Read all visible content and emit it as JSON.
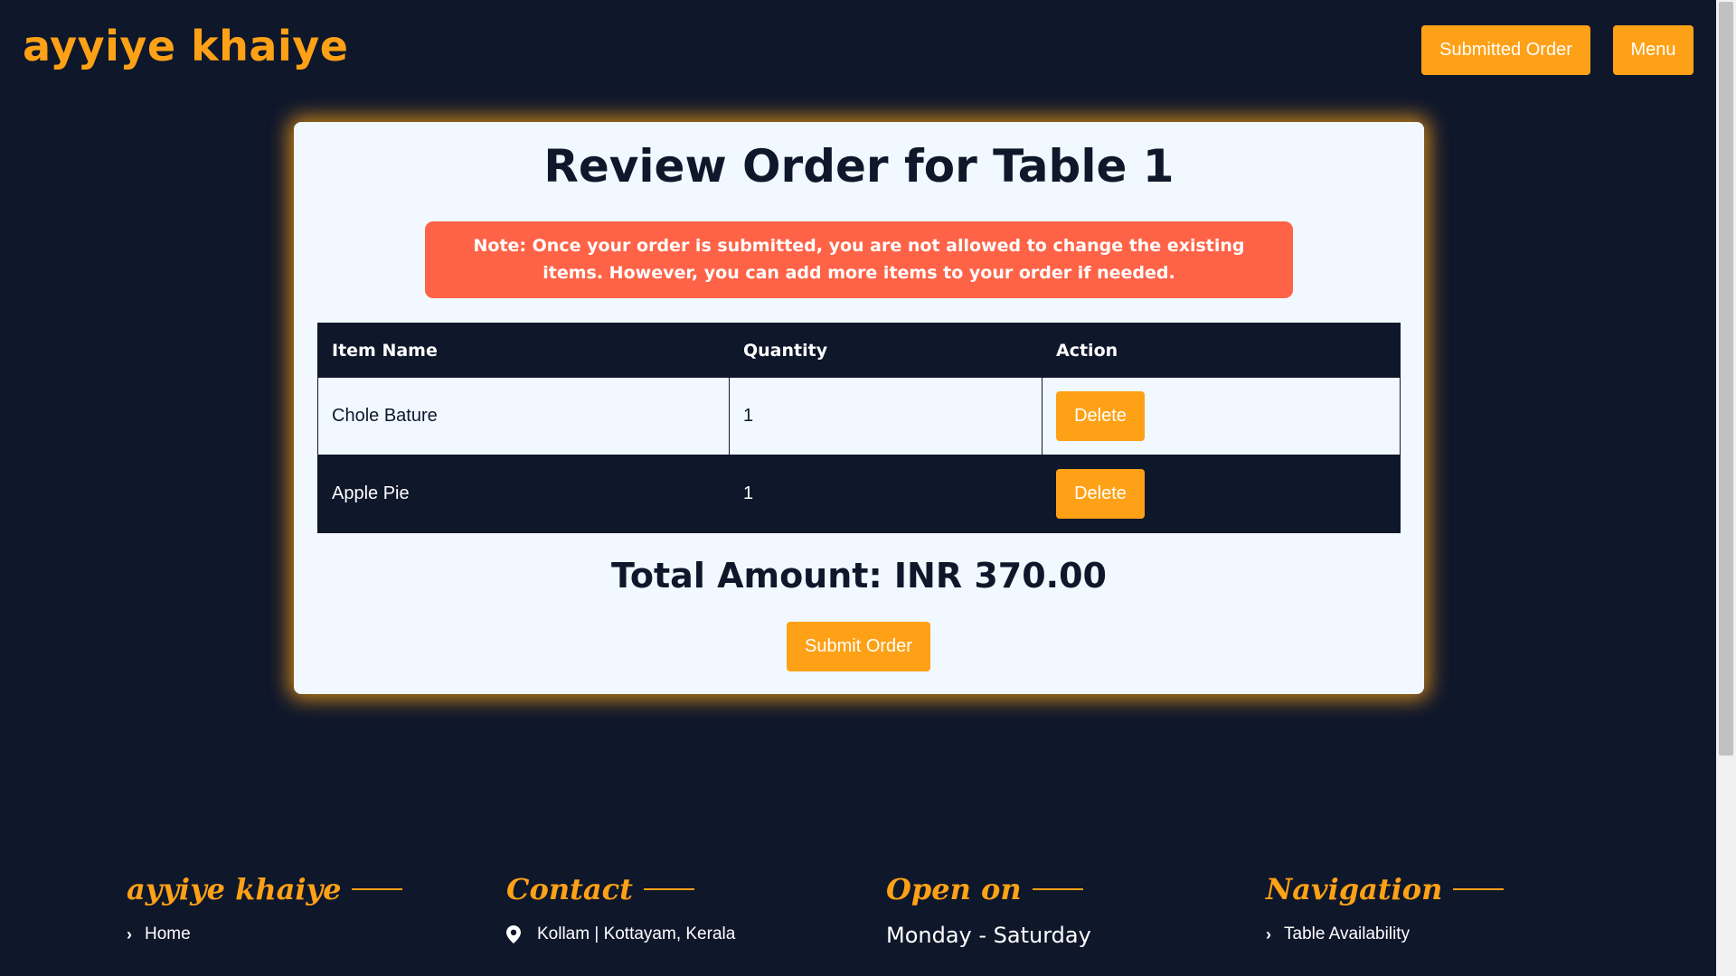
{
  "header": {
    "brand": "ayyiye khaiye",
    "submitted_order_label": "Submitted Order",
    "menu_label": "Menu"
  },
  "card": {
    "title": "Review Order for Table 1",
    "note_label": "Note:",
    "note_text": " Once your order is submitted, you are not allowed to change the existing items. However, you can add more items to your order if needed.",
    "table": {
      "headers": [
        "Item Name",
        "Quantity",
        "Action"
      ],
      "rows": [
        {
          "item": "Chole Bature",
          "quantity": "1",
          "action": "Delete"
        },
        {
          "item": "Apple Pie",
          "quantity": "1",
          "action": "Delete"
        }
      ]
    },
    "total": "Total Amount: INR 370.00",
    "submit_label": "Submit Order"
  },
  "footer": {
    "brand_heading": "ayyiye khaiye",
    "brand_link": "Home",
    "contact_heading": "Contact",
    "contact_address": "Kollam | Kottayam, Kerala",
    "open_heading": "Open on",
    "open_days": "Monday - Saturday",
    "nav_heading": "Navigation",
    "nav_link": "Table Availability"
  },
  "colors": {
    "background": "#0f172b",
    "accent": "#fea116",
    "card": "#f1f8ff",
    "note": "#ff6347"
  },
  "icons": [
    "chevron-right-icon",
    "map-pin-icon"
  ]
}
